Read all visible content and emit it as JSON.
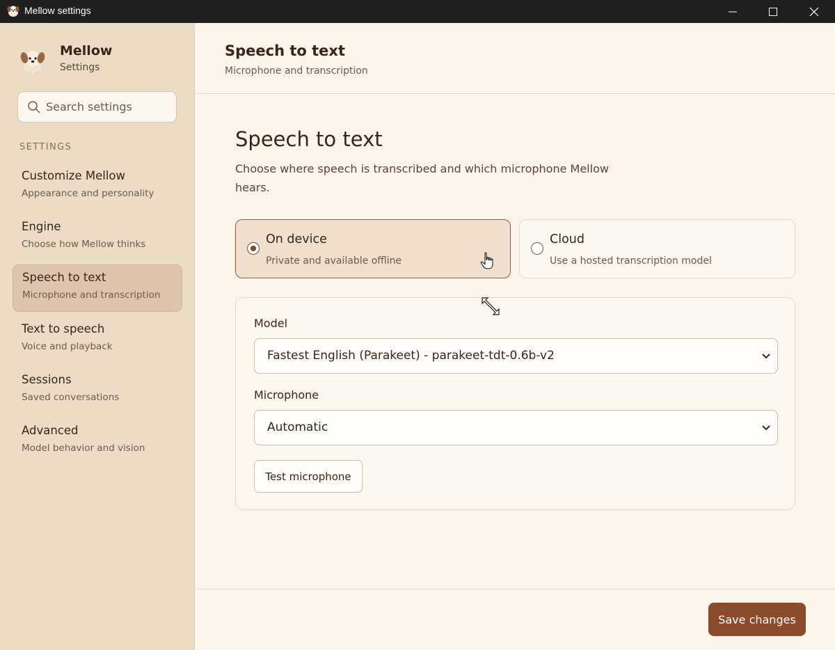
{
  "window": {
    "title": "Mellow settings"
  },
  "sidebar": {
    "brand_name": "Mellow",
    "brand_sub": "Settings",
    "search_placeholder": "Search settings",
    "section_label": "SETTINGS",
    "items": [
      {
        "title": "Customize Mellow",
        "desc": "Appearance and personality"
      },
      {
        "title": "Engine",
        "desc": "Choose how Mellow thinks"
      },
      {
        "title": "Speech to text",
        "desc": "Microphone and transcription"
      },
      {
        "title": "Text to speech",
        "desc": "Voice and playback"
      },
      {
        "title": "Sessions",
        "desc": "Saved conversations"
      },
      {
        "title": "Advanced",
        "desc": "Model behavior and vision"
      }
    ]
  },
  "header": {
    "title": "Speech to text",
    "subtitle": "Microphone and transcription"
  },
  "main": {
    "title": "Speech to text",
    "description": "Choose where speech is transcribed and which microphone Mellow hears.",
    "options": [
      {
        "title": "On device",
        "desc": "Private and available offline"
      },
      {
        "title": "Cloud",
        "desc": "Use a hosted transcription model"
      }
    ],
    "model_label": "Model",
    "model_value": "Fastest English (Parakeet) - parakeet-tdt-0.6b-v2",
    "microphone_label": "Microphone",
    "microphone_value": "Automatic",
    "test_label": "Test microphone"
  },
  "footer": {
    "save_label": "Save changes"
  },
  "colors": {
    "accent": "#8c4a2c",
    "sidebar_bg": "#ecdcc6",
    "selected_bg": "#efdfcc",
    "page_bg": "#faf4ea"
  }
}
